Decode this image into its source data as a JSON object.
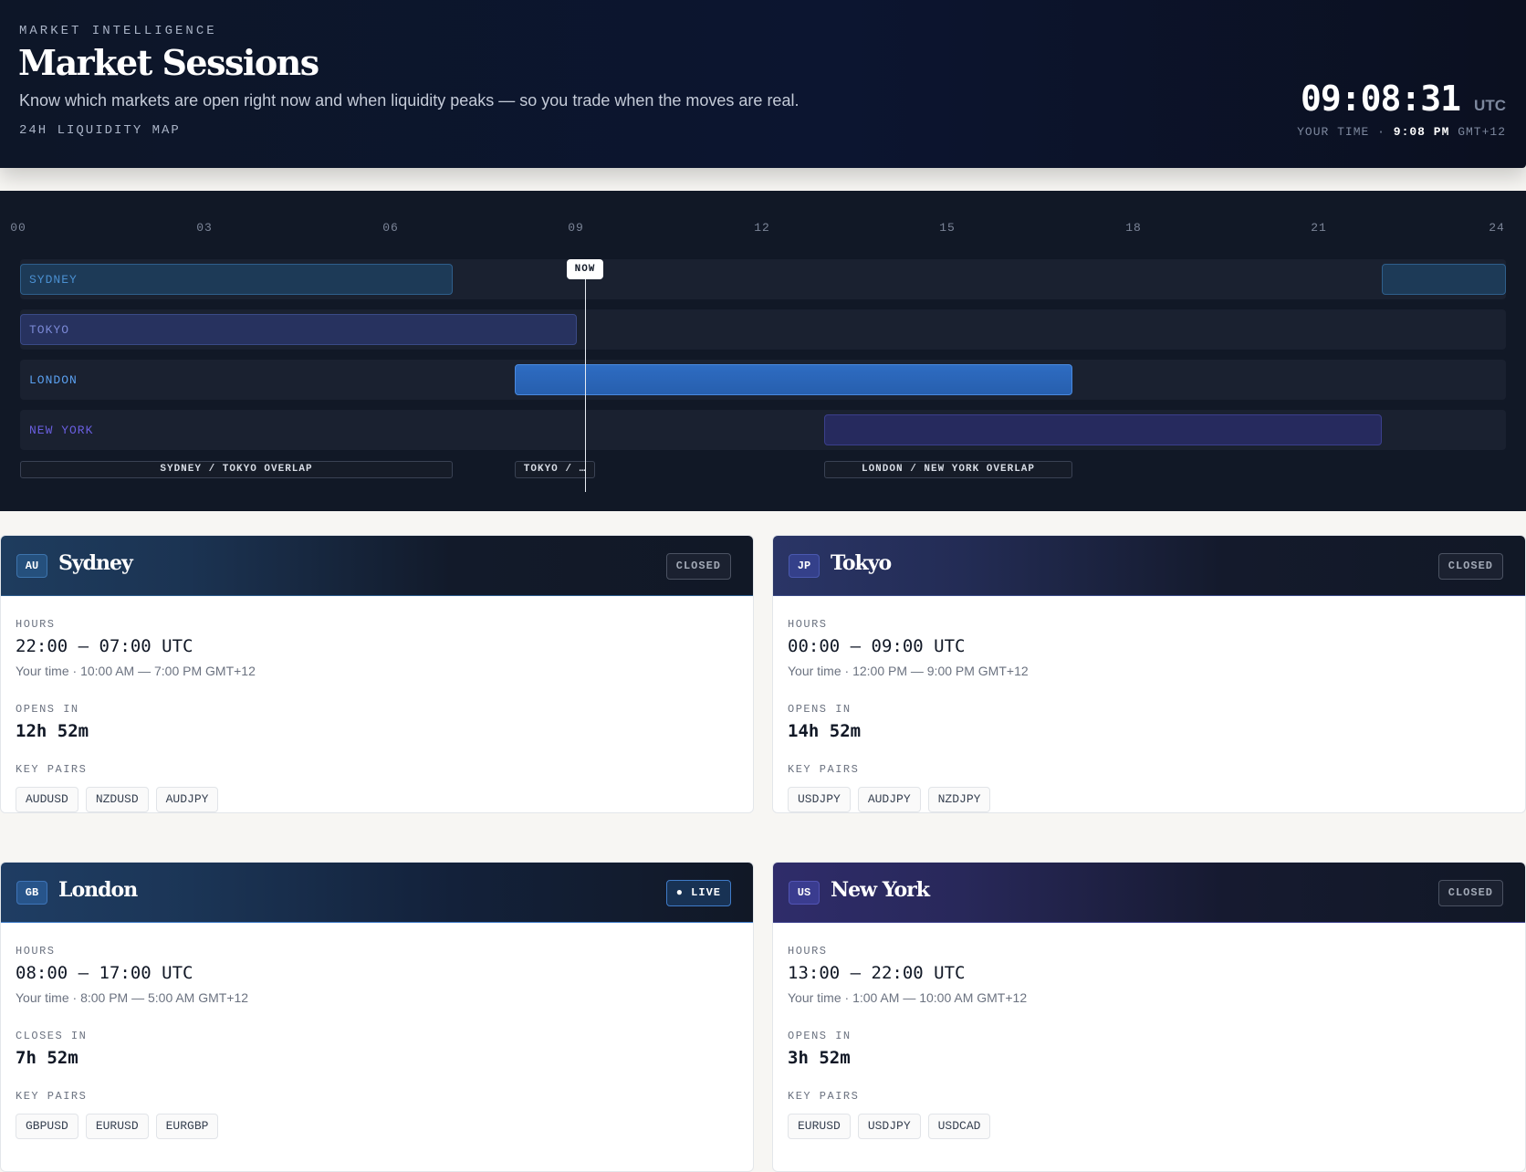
{
  "header": {
    "eyebrow": "MARKET INTELLIGENCE",
    "title": "Market Sessions",
    "subtitle": "Know which markets are open right now and when liquidity peaks — so you trade when the moves are real.",
    "map_label": "24H LIQUIDITY MAP",
    "clock": "09:08:31",
    "clock_zone": "UTC",
    "your_time_label": "YOUR TIME ·",
    "your_time_value": "9:08 PM",
    "your_time_zone": "GMT+12"
  },
  "timeline": {
    "ticks": [
      "00",
      "03",
      "06",
      "09",
      "12",
      "15",
      "18",
      "21",
      "24"
    ],
    "now_label": "NOW",
    "now_hour": 9.14,
    "tracks": [
      {
        "label": "SYDNEY",
        "color": "#4a8fd0"
      },
      {
        "label": "TOKYO",
        "color": "#7b89d6"
      },
      {
        "label": "LONDON",
        "color": "#5aa0f0"
      },
      {
        "label": "NEW YORK",
        "color": "#6a5fe0"
      }
    ],
    "overlaps": [
      {
        "label": "SYDNEY / TOKYO OVERLAP"
      },
      {
        "label": "TOKYO / …"
      },
      {
        "label": "LONDON / NEW YORK OVERLAP"
      }
    ]
  },
  "cards": [
    {
      "code": "AU",
      "city": "Sydney",
      "status": "CLOSED",
      "hours_label": "HOURS",
      "hours": "22:00 — 07:00 UTC",
      "local": "Your time · 10:00 AM — 7:00 PM GMT+12",
      "countdown_label": "OPENS IN",
      "countdown": "12h 52m",
      "pairs_label": "KEY PAIRS",
      "pairs": [
        "AUDUSD",
        "NZDUSD",
        "AUDJPY"
      ]
    },
    {
      "code": "JP",
      "city": "Tokyo",
      "status": "CLOSED",
      "hours_label": "HOURS",
      "hours": "00:00 — 09:00 UTC",
      "local": "Your time · 12:00 PM — 9:00 PM GMT+12",
      "countdown_label": "OPENS IN",
      "countdown": "14h 52m",
      "pairs_label": "KEY PAIRS",
      "pairs": [
        "USDJPY",
        "AUDJPY",
        "NZDJPY"
      ]
    },
    {
      "code": "GB",
      "city": "London",
      "status": "● LIVE",
      "hours_label": "HOURS",
      "hours": "08:00 — 17:00 UTC",
      "local": "Your time · 8:00 PM — 5:00 AM GMT+12",
      "countdown_label": "CLOSES IN",
      "countdown": "7h 52m",
      "pairs_label": "KEY PAIRS",
      "pairs": [
        "GBPUSD",
        "EURUSD",
        "EURGBP"
      ]
    },
    {
      "code": "US",
      "city": "New York",
      "status": "CLOSED",
      "hours_label": "HOURS",
      "hours": "13:00 — 22:00 UTC",
      "local": "Your time · 1:00 AM — 10:00 AM GMT+12",
      "countdown_label": "OPENS IN",
      "countdown": "3h 52m",
      "pairs_label": "KEY PAIRS",
      "pairs": [
        "EURUSD",
        "USDJPY",
        "USDCAD"
      ]
    }
  ]
}
